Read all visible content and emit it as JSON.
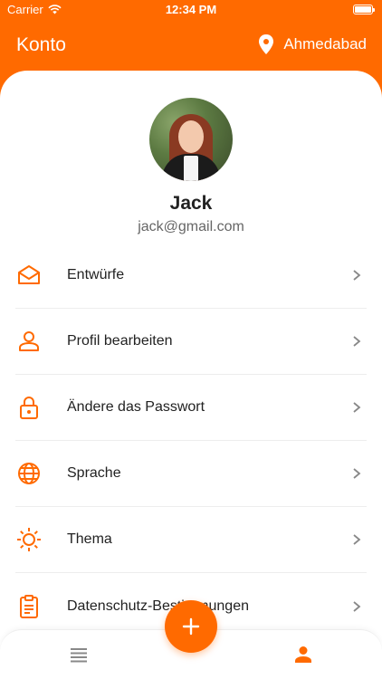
{
  "status_bar": {
    "carrier": "Carrier",
    "time": "12:34 PM"
  },
  "header": {
    "title": "Konto",
    "location": "Ahmedabad"
  },
  "profile": {
    "name": "Jack",
    "email": "jack@gmail.com"
  },
  "menu": [
    {
      "label": "Entwürfe",
      "icon": "envelope-icon"
    },
    {
      "label": "Profil bearbeiten",
      "icon": "user-icon"
    },
    {
      "label": "Ändere das Passwort",
      "icon": "lock-icon"
    },
    {
      "label": "Sprache",
      "icon": "globe-icon"
    },
    {
      "label": "Thema",
      "icon": "sun-icon"
    },
    {
      "label": "Datenschutz-Bestimmungen",
      "icon": "clipboard-icon"
    }
  ],
  "colors": {
    "accent": "#ff6a00",
    "text": "#222222",
    "muted": "#666666"
  },
  "bottom_nav": {
    "active": "profile"
  }
}
